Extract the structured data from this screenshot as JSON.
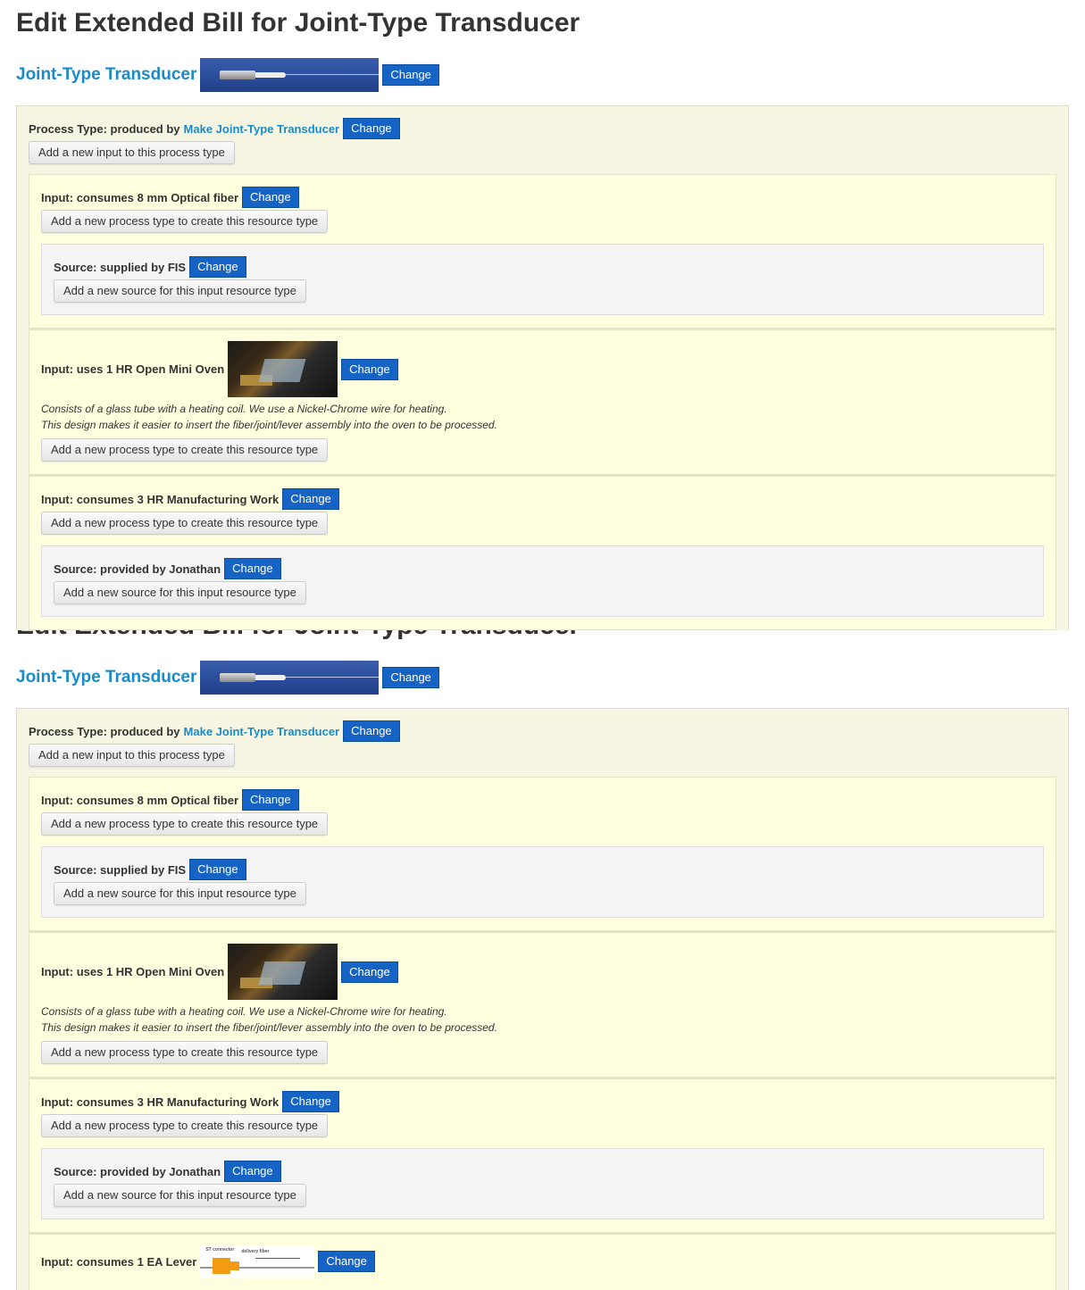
{
  "page": {
    "heading": "Edit Extended Bill for Joint-Type Transducer",
    "resource_link": "Joint-Type Transducer",
    "change_label": "Change"
  },
  "process": {
    "label": "Process Type: produced by",
    "link": "Make Joint-Type Transducer",
    "add_input_label": "Add a new input to this process type"
  },
  "inputs": [
    {
      "label": "Input: consumes 8 mm Optical fiber",
      "add_process_label": "Add a new process type to create this resource type",
      "source": {
        "label": "Source: supplied by FIS",
        "add_source_label": "Add a new source for this input resource type"
      }
    },
    {
      "label": "Input: uses 1 HR Open Mini Oven",
      "description_line1": "Consists of a glass tube with a heating coil. We use a Nickel-Chrome wire for heating.",
      "description_line2": "This design makes it easier to insert the fiber/joint/lever assembly into the oven to be processed.",
      "add_process_label": "Add a new process type to create this resource type"
    },
    {
      "label": "Input: consumes 3 HR Manufacturing Work",
      "add_process_label": "Add a new process type to create this resource type",
      "source": {
        "label": "Source: provided by Jonathan",
        "add_source_label": "Add a new source for this input resource type"
      }
    },
    {
      "label": "Input: consumes 1 EA Lever",
      "lever_image_text": [
        "ST connector",
        "delivery fiber",
        "125mm"
      ]
    }
  ]
}
